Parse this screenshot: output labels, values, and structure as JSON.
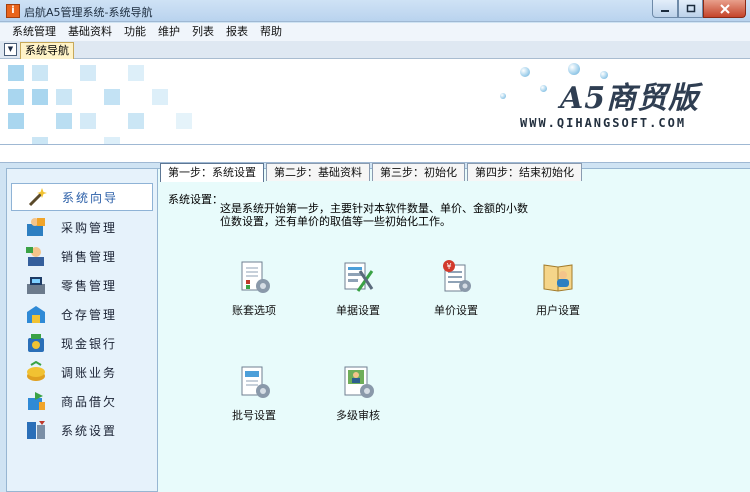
{
  "window": {
    "title": "启航A5管理系统-系统导航",
    "app_icon_glyph": "i"
  },
  "menu": [
    "系统管理",
    "基础资料",
    "功能",
    "维护",
    "列表",
    "报表",
    "帮助"
  ],
  "doc_tab": {
    "label": "系统导航"
  },
  "banner": {
    "title": "A5商贸版",
    "url": "WWW.QIHANGSOFT.COM"
  },
  "sidebar": {
    "items": [
      {
        "label": "系统向导",
        "icon": "wand-icon",
        "active": true
      },
      {
        "label": "采购管理",
        "icon": "purchase-icon"
      },
      {
        "label": "销售管理",
        "icon": "sales-icon"
      },
      {
        "label": "零售管理",
        "icon": "retail-icon"
      },
      {
        "label": "仓存管理",
        "icon": "warehouse-icon"
      },
      {
        "label": "现金银行",
        "icon": "cash-bank-icon"
      },
      {
        "label": "调账业务",
        "icon": "adjust-icon"
      },
      {
        "label": "商品借欠",
        "icon": "borrow-icon"
      },
      {
        "label": "系统设置",
        "icon": "settings-icon"
      }
    ]
  },
  "steps": [
    {
      "label": "第一步：系统设置",
      "active": true
    },
    {
      "label": "第二步：基础资料"
    },
    {
      "label": "第三步：初始化"
    },
    {
      "label": "第四步：结束初始化"
    }
  ],
  "step1": {
    "heading": "系统设置：",
    "description_line1": "这是系统开始第一步，主要针对本软件数量、单价、金额的小数",
    "description_line2": "位数设置，还有单价的取值等一些初始化工作。",
    "functions": [
      {
        "label": "账套选项",
        "icon": "account-options-icon"
      },
      {
        "label": "单据设置",
        "icon": "document-settings-icon"
      },
      {
        "label": "单价设置",
        "icon": "price-settings-icon"
      },
      {
        "label": "用户设置",
        "icon": "user-settings-icon"
      },
      {
        "label": "批号设置",
        "icon": "batch-settings-icon"
      },
      {
        "label": "多级审核",
        "icon": "multi-level-audit-icon"
      }
    ]
  },
  "colors": {
    "accent": "#2b5fa8",
    "panel_bg": "#e8fbfb",
    "sidebar_bg": "#e6f2fb"
  }
}
